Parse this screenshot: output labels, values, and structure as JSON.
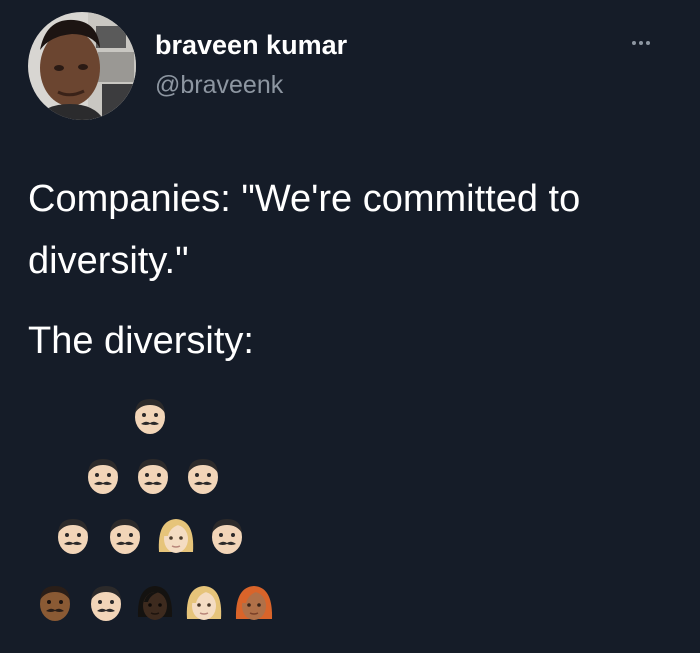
{
  "author": {
    "display_name": "braveen kumar",
    "handle": "@braveenk"
  },
  "menu": {
    "icon": "more-horizontal-icon"
  },
  "tweet": {
    "line1": "Companies: \"We're committed to diversity.\"",
    "line2": "The diversity:"
  },
  "pyramid": {
    "rows": [
      [
        "man-light-skin-mustache"
      ],
      [
        "man-light-skin-mustache",
        "man-light-skin-mustache",
        "man-light-skin-mustache"
      ],
      [
        "man-light-skin-mustache",
        "man-light-skin-mustache",
        "woman-blonde-light-skin",
        "man-light-skin-mustache"
      ],
      [
        "man-medium-dark-skin-mustache",
        "man-light-skin-mustache",
        "woman-dark-skin",
        "woman-blonde-light-skin",
        "woman-red-hair"
      ]
    ]
  }
}
